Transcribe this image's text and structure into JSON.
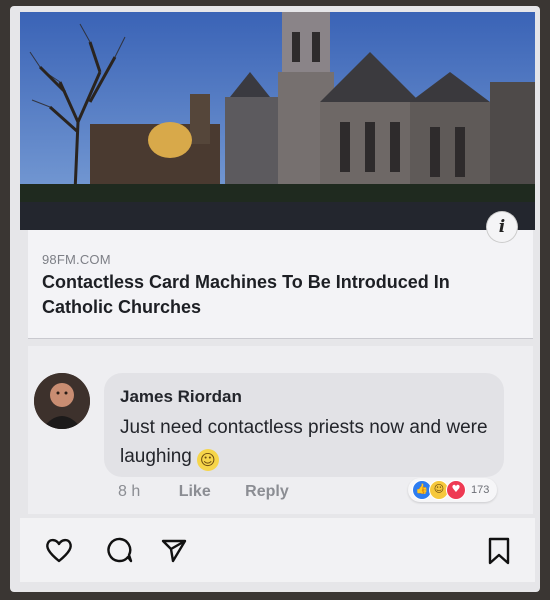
{
  "post": {
    "source_domain": "98FM.COM",
    "headline": "Contactless Card Machines To Be Introduced In Catholic Churches",
    "info_icon_glyph": "i"
  },
  "comment": {
    "author": "James Riordan",
    "text": "Just need contactless priests now and were laughing",
    "emoji": "grinning-face-emoji",
    "time": "8 h",
    "like_label": "Like",
    "reply_label": "Reply",
    "reactions": [
      "like-icon",
      "haha-icon",
      "love-icon"
    ],
    "reaction_count": "173"
  },
  "toolbar": {
    "icons": [
      "heart-icon",
      "comment-icon",
      "send-icon",
      "bookmark-icon"
    ]
  },
  "colors": {
    "like": "#2d7cf0",
    "love": "#ee3a53",
    "haha": "#f6c83c"
  }
}
